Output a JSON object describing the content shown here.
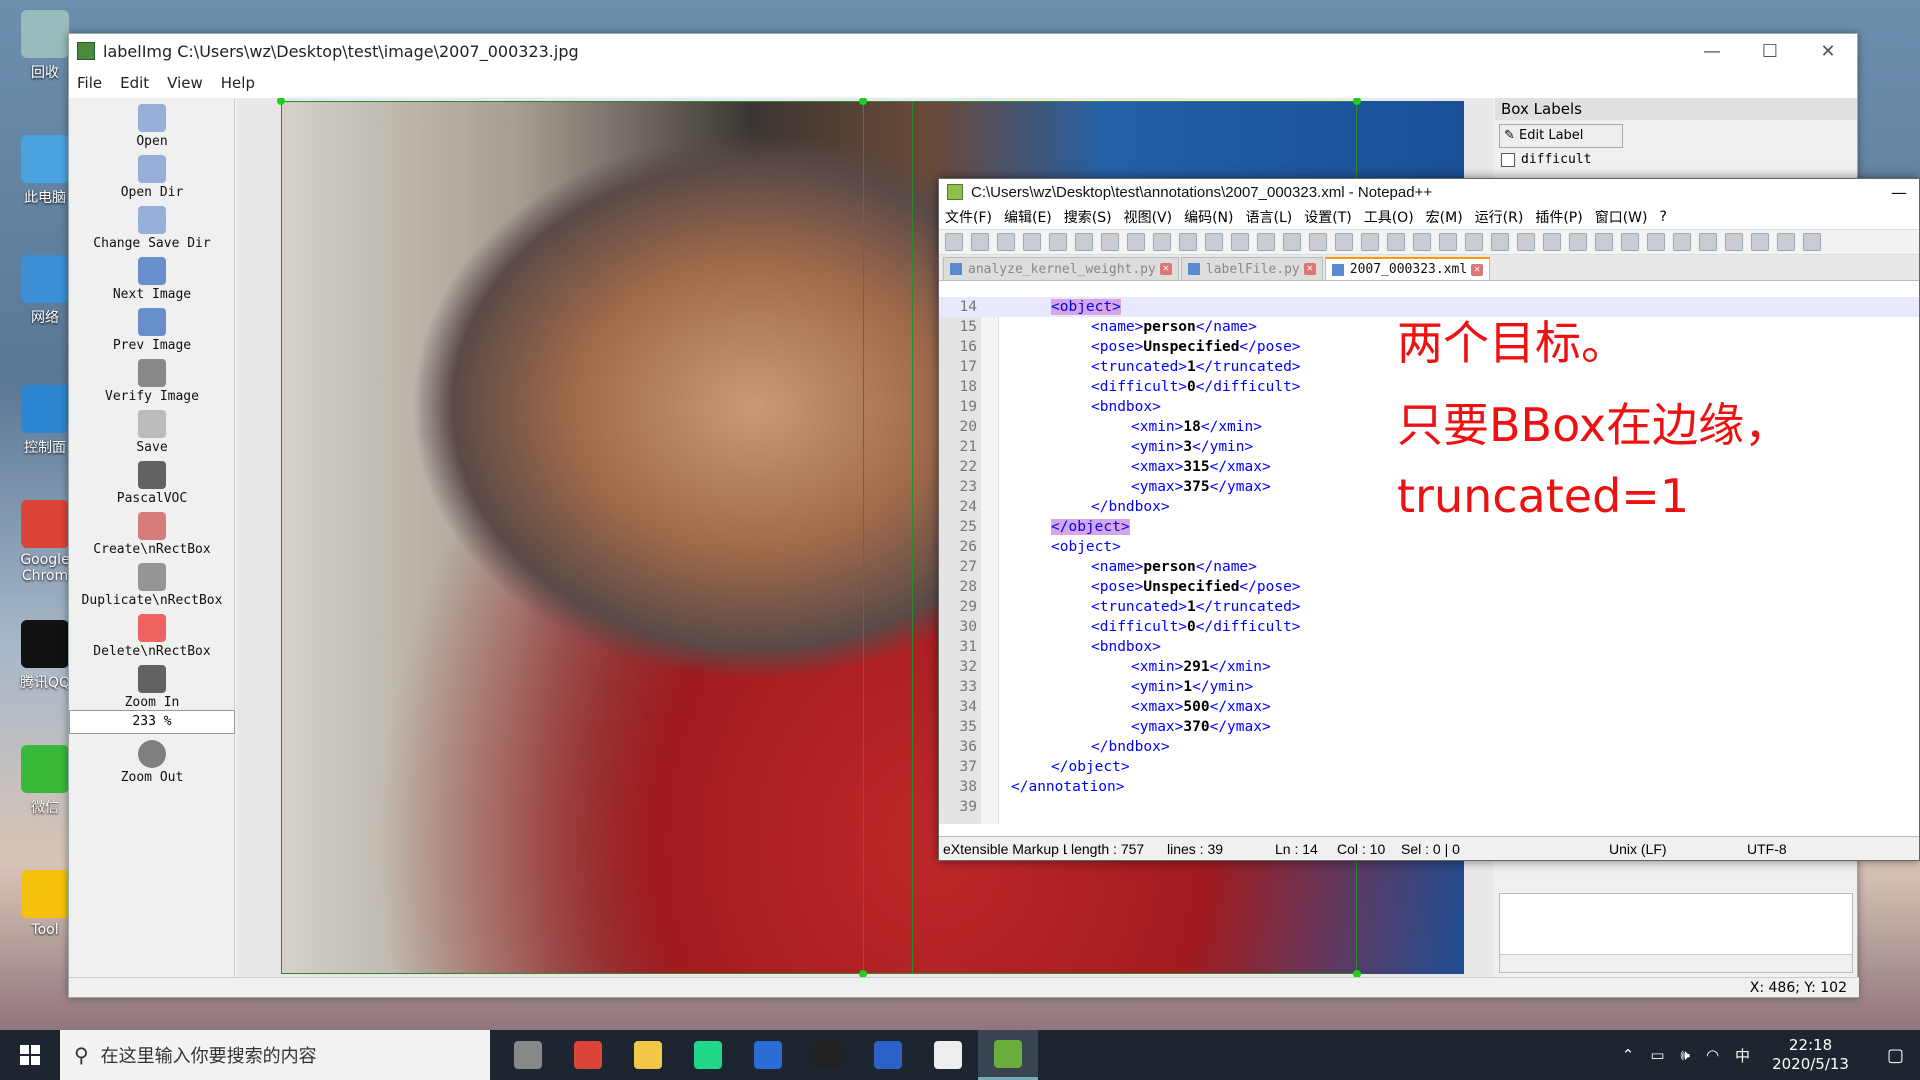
{
  "desktop": {
    "icons": [
      {
        "label": "回收",
        "color": "#9bb"
      },
      {
        "label": "此电脑",
        "color": "#4aa3e0"
      },
      {
        "label": "网络",
        "color": "#3a8fd6"
      },
      {
        "label": "控制面",
        "color": "#2d86d1"
      },
      {
        "label": "Google Chrom",
        "color": "#db4437"
      },
      {
        "label": "腾讯QQ",
        "color": "#111"
      },
      {
        "label": "微信",
        "color": "#3ab83a"
      },
      {
        "label": "Tool",
        "color": "#f4c20d"
      }
    ]
  },
  "labelimg": {
    "title": "labelImg C:\\Users\\wz\\Desktop\\test\\image\\2007_000323.jpg",
    "menu": [
      "File",
      "Edit",
      "View",
      "Help"
    ],
    "toolbar": [
      {
        "label": "Open",
        "icon": "folder-open-icon"
      },
      {
        "label": "Open Dir",
        "icon": "folder-open-icon"
      },
      {
        "label": "Change Save Dir",
        "icon": "folder-open-icon"
      },
      {
        "label": "Next Image",
        "icon": "arrow-right-icon"
      },
      {
        "label": "Prev Image",
        "icon": "arrow-left-icon"
      },
      {
        "label": "Verify Image",
        "icon": "checkbox-icon"
      },
      {
        "label": "Save",
        "icon": "save-icon"
      },
      {
        "label": "PascalVOC",
        "icon": "code-icon"
      },
      {
        "label": "Create\\nRectBox",
        "icon": "create-rect-icon"
      },
      {
        "label": "Duplicate\\nRectBox",
        "icon": "duplicate-icon"
      },
      {
        "label": "Delete\\nRectBox",
        "icon": "delete-icon"
      },
      {
        "label": "Zoom In",
        "icon": "zoom-in-icon"
      }
    ],
    "zoom_value": "233 %",
    "zoom_out_label": "Zoom Out",
    "box_labels_header": "Box Labels",
    "edit_label": "Edit Label",
    "difficult_label": "difficult",
    "status": "X: 486; Y: 102"
  },
  "notepad": {
    "title": "C:\\Users\\wz\\Desktop\\test\\annotations\\2007_000323.xml - Notepad++",
    "menu": [
      "文件(F)",
      "编辑(E)",
      "搜索(S)",
      "视图(V)",
      "编码(N)",
      "语言(L)",
      "设置(T)",
      "工具(O)",
      "宏(M)",
      "运行(R)",
      "插件(P)",
      "窗口(W)",
      "?"
    ],
    "tabs": [
      {
        "label": "analyze_kernel_weight.py",
        "active": false
      },
      {
        "label": "labelFile.py",
        "active": false
      },
      {
        "label": "2007_000323.xml",
        "active": true
      }
    ],
    "lines": [
      {
        "n": "14",
        "indent": 1,
        "text": "<object>",
        "hl": true,
        "cur": true
      },
      {
        "n": "15",
        "indent": 2,
        "open": "<name>",
        "val": "person",
        "close": "</name>"
      },
      {
        "n": "16",
        "indent": 2,
        "open": "<pose>",
        "val": "Unspecified",
        "close": "</pose>"
      },
      {
        "n": "17",
        "indent": 2,
        "open": "<truncated>",
        "val": "1",
        "close": "</truncated>"
      },
      {
        "n": "18",
        "indent": 2,
        "open": "<difficult>",
        "val": "0",
        "close": "</difficult>"
      },
      {
        "n": "19",
        "indent": 2,
        "text": "<bndbox>"
      },
      {
        "n": "20",
        "indent": 3,
        "open": "<xmin>",
        "val": "18",
        "close": "</xmin>"
      },
      {
        "n": "21",
        "indent": 3,
        "open": "<ymin>",
        "val": "3",
        "close": "</ymin>"
      },
      {
        "n": "22",
        "indent": 3,
        "open": "<xmax>",
        "val": "315",
        "close": "</xmax>"
      },
      {
        "n": "23",
        "indent": 3,
        "open": "<ymax>",
        "val": "375",
        "close": "</ymax>"
      },
      {
        "n": "24",
        "indent": 2,
        "text": "</bndbox>"
      },
      {
        "n": "25",
        "indent": 1,
        "text": "</object>",
        "hl": true
      },
      {
        "n": "26",
        "indent": 1,
        "text": "<object>"
      },
      {
        "n": "27",
        "indent": 2,
        "open": "<name>",
        "val": "person",
        "close": "</name>"
      },
      {
        "n": "28",
        "indent": 2,
        "open": "<pose>",
        "val": "Unspecified",
        "close": "</pose>"
      },
      {
        "n": "29",
        "indent": 2,
        "open": "<truncated>",
        "val": "1",
        "close": "</truncated>"
      },
      {
        "n": "30",
        "indent": 2,
        "open": "<difficult>",
        "val": "0",
        "close": "</difficult>"
      },
      {
        "n": "31",
        "indent": 2,
        "text": "<bndbox>"
      },
      {
        "n": "32",
        "indent": 3,
        "open": "<xmin>",
        "val": "291",
        "close": "</xmin>"
      },
      {
        "n": "33",
        "indent": 3,
        "open": "<ymin>",
        "val": "1",
        "close": "</ymin>"
      },
      {
        "n": "34",
        "indent": 3,
        "open": "<xmax>",
        "val": "500",
        "close": "</xmax>"
      },
      {
        "n": "35",
        "indent": 3,
        "open": "<ymax>",
        "val": "370",
        "close": "</ymax>"
      },
      {
        "n": "36",
        "indent": 2,
        "text": "</bndbox>"
      },
      {
        "n": "37",
        "indent": 1,
        "text": "</object>"
      },
      {
        "n": "38",
        "indent": 0,
        "text": "</annotation>"
      },
      {
        "n": "39",
        "indent": 0,
        "text": ""
      }
    ],
    "status": {
      "lang": "eXtensible Markup La",
      "length": "length : 757",
      "lines": "lines : 39",
      "ln": "Ln : 14",
      "col": "Col : 10",
      "sel": "Sel : 0 | 0",
      "eol": "Unix (LF)",
      "enc": "UTF-8"
    }
  },
  "annotation": {
    "line1": "两个目标。",
    "line2": "只要BBox在边缘，",
    "line3": "truncated=1"
  },
  "taskbar": {
    "search_placeholder": "在这里输入你要搜索的内容",
    "apps": [
      {
        "name": "task-view-icon",
        "color": "#888"
      },
      {
        "name": "chrome-icon",
        "color": "#db4437"
      },
      {
        "name": "file-explorer-icon",
        "color": "#f2c84b"
      },
      {
        "name": "pycharm-icon",
        "color": "#21d789"
      },
      {
        "name": "word-icon",
        "color": "#2b6cd6"
      },
      {
        "name": "terminal-icon",
        "color": "#222"
      },
      {
        "name": "powershell-icon",
        "color": "#2a62c8"
      },
      {
        "name": "notepad-icon",
        "color": "#eee"
      },
      {
        "name": "labelimg-icon",
        "color": "#6cae3c"
      }
    ],
    "ime": "中",
    "time": "22:18",
    "date": "2020/5/13"
  }
}
